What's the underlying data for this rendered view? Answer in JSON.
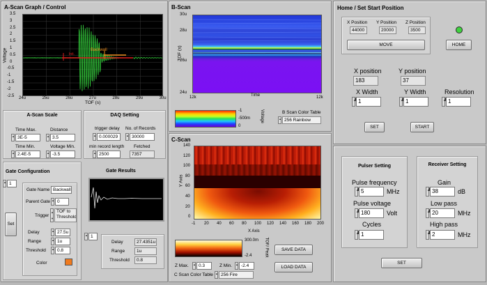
{
  "ascan": {
    "title": "A-Scan Graph / Control",
    "ylabel": "Voltage",
    "xlabel": "TOF (s)",
    "xticks": [
      "24u",
      "25u",
      "26u",
      "27u",
      "28u",
      "29u",
      "30u"
    ],
    "yticks": [
      "3.5",
      "3",
      "2.5",
      "2",
      "1.5",
      "1",
      "0.5",
      "0",
      "-0.5",
      "-1",
      "-1.5",
      "-2",
      "-2.5"
    ],
    "gate_labels": [
      "Backwall",
      "Init."
    ]
  },
  "scale": {
    "title": "A-Scan Scale",
    "time_max_label": "Time Max.",
    "time_max": "3E-5",
    "distance_label": "Distance",
    "distance": "3.5",
    "time_min_label": "Time Min.",
    "time_min": "2.4E-5",
    "voltage_min_label": "Voltage Min.",
    "voltage_min": "-3.5"
  },
  "daq": {
    "title": "DAQ Setting",
    "trigger_delay_label": "trigger delay",
    "trigger_delay": "0.000029",
    "records_label": "No. of Records",
    "records": "30000",
    "min_len_label": "min record length",
    "min_len": "2500",
    "fetched_label": "Fetched",
    "fetched": "7357"
  },
  "gate": {
    "title": "Gate Configuration",
    "index": "1",
    "name_label": "Gate Name",
    "name": "Backwall",
    "parent_label": "Parent Gate",
    "parent": "0",
    "trigger_label": "Trigger",
    "trigger": "TOF to Threshold",
    "set_label": "Set",
    "delay_label": "Delay",
    "delay": "27.5u",
    "range_label": "Range",
    "range": "1u",
    "threshold_label": "Threshold",
    "threshold": "0.8",
    "color_label": "Color",
    "color": "#f07a1e"
  },
  "gate_results": {
    "title": "Gate Results",
    "index": "1",
    "delay_label": "Delay",
    "delay": "27.4351u",
    "range_label": "Range",
    "range": "1u",
    "threshold_label": "Threshold",
    "threshold": "0.8"
  },
  "bscan": {
    "title": "B-Scan",
    "ylabel": "TOF (s)",
    "xlabel": "Time",
    "yticks": [
      "30u",
      "28u",
      "26u",
      "24u"
    ],
    "xleft": "12k",
    "xright": "12k",
    "cbar_ticks": [
      "-1",
      "-500m",
      "0"
    ],
    "cbar_label": "Voltage",
    "ctable_label": "B Scan Color Table",
    "ctable": "256 Rainbow"
  },
  "cscan": {
    "title": "C-Scan",
    "ylabel": "Y Axis",
    "xlabel": "X Axis",
    "yticks": [
      "140",
      "120",
      "100",
      "80",
      "60",
      "40",
      "20",
      "0"
    ],
    "xticks": [
      "-1",
      "20",
      "40",
      "60",
      "80",
      "100",
      "120",
      "140",
      "160",
      "180",
      "200"
    ],
    "cbar_ticks": [
      "300.0m",
      "-2.4"
    ],
    "cbar_label": "TOF/ Peak",
    "zmax_label": "Z Max.",
    "zmax": "0.3",
    "zmin_label": "Z Min.",
    "zmin": "-2.4",
    "ctable_label": "C Scan Color Table",
    "ctable": "256 Fire",
    "save_label": "SAVE DATA",
    "load_label": "LOAD DATA"
  },
  "home": {
    "title": "Home / Set Start Position",
    "xpos_label": "X Position",
    "xpos": "44000",
    "ypos_label": "Y Position",
    "ypos": "20000",
    "zpos_label": "Z Position",
    "zpos": "3500",
    "move_label": "MOVE",
    "home_label": "HOME",
    "led_color": "#3fd23f",
    "x_position_label": "X position",
    "x_position": "183",
    "y_position_label": "Y position",
    "y_position": "37",
    "x_width_label": "X Width",
    "x_width": "1",
    "y_width_label": "Y Width",
    "y_width": "1",
    "resolution_label": "Resolution",
    "resolution": "1",
    "set_label": "SET",
    "start_label": "START"
  },
  "pulser": {
    "title": "Pulser Setting",
    "freq_label": "Pulse frequency",
    "freq": "5",
    "freq_unit": "MHz",
    "volt_label": "Pulse voltage",
    "volt": "180",
    "volt_unit": "Volt",
    "cycles_label": "Cycles",
    "cycles": "1"
  },
  "receiver": {
    "title": "Receiver Setting",
    "gain_label": "Gain",
    "gain": "38",
    "gain_unit": "dB",
    "low_label": "Low pass",
    "low": "20",
    "low_unit": "MHz",
    "high_label": "High pass",
    "high": "2",
    "high_unit": "MHz",
    "set_label": "SET"
  }
}
